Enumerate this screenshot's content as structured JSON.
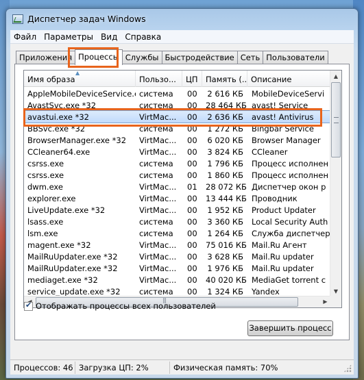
{
  "window": {
    "title": "Диспетчер задач Windows"
  },
  "menu": [
    "Файл",
    "Параметры",
    "Вид",
    "Справка"
  ],
  "tabs": [
    "Приложения",
    "Процессы",
    "Службы",
    "Быстродействие",
    "Сеть",
    "Пользователи"
  ],
  "active_tab": "Процессы",
  "columns": [
    "Имя образа",
    "Пользо...",
    "ЦП",
    "Память (...",
    "Описание"
  ],
  "sorted_column": "Имя образа",
  "processes": [
    {
      "name": "AppleMobileDeviceService.exe",
      "user": "система",
      "cpu": "00",
      "mem": "2 616 КБ",
      "desc": "MobileDeviceServi"
    },
    {
      "name": "AvastSvc.exe *32",
      "user": "система",
      "cpu": "00",
      "mem": "28 464 КБ",
      "desc": "avast! Service"
    },
    {
      "name": "avastui.exe *32",
      "user": "VirtMac...",
      "cpu": "00",
      "mem": "2 636 КБ",
      "desc": "avast! Antivirus"
    },
    {
      "name": "BBSvc.exe *32",
      "user": "система",
      "cpu": "00",
      "mem": "1 272 КБ",
      "desc": "Bingbar Service"
    },
    {
      "name": "BrowserManager.exe *32",
      "user": "VirtMac...",
      "cpu": "00",
      "mem": "6 020 КБ",
      "desc": "Browser Manager"
    },
    {
      "name": "CCleaner64.exe",
      "user": "VirtMac...",
      "cpu": "00",
      "mem": "3 824 КБ",
      "desc": "CCleaner"
    },
    {
      "name": "csrss.exe",
      "user": "система",
      "cpu": "00",
      "mem": "1 796 КБ",
      "desc": "Процесс исполнен"
    },
    {
      "name": "csrss.exe",
      "user": "система",
      "cpu": "00",
      "mem": "1 860 КБ",
      "desc": "Процесс исполнен"
    },
    {
      "name": "dwm.exe",
      "user": "VirtMac...",
      "cpu": "01",
      "mem": "28 072 КБ",
      "desc": "Диспетчер окон р"
    },
    {
      "name": "explorer.exe",
      "user": "VirtMac...",
      "cpu": "00",
      "mem": "13 444 КБ",
      "desc": "Проводник"
    },
    {
      "name": "LiveUpdate.exe *32",
      "user": "VirtMac...",
      "cpu": "00",
      "mem": "1 952 КБ",
      "desc": "Product Updater"
    },
    {
      "name": "lsass.exe",
      "user": "система",
      "cpu": "00",
      "mem": "3 360 КБ",
      "desc": "Local Security Auth"
    },
    {
      "name": "lsm.exe",
      "user": "система",
      "cpu": "00",
      "mem": "1 264 КБ",
      "desc": "Служба диспетчер"
    },
    {
      "name": "magent.exe *32",
      "user": "VirtMac...",
      "cpu": "00",
      "mem": "75 016 КБ",
      "desc": "Mail.Ru Агент"
    },
    {
      "name": "MailRuUpdater.exe *32",
      "user": "VirtMac...",
      "cpu": "00",
      "mem": "3 628 КБ",
      "desc": "Mail.Ru updater"
    },
    {
      "name": "MailRuUpdater.exe *32",
      "user": "VirtMac...",
      "cpu": "00",
      "mem": "1 976 КБ",
      "desc": "Mail.Ru updater"
    },
    {
      "name": "mediaget.exe *32",
      "user": "VirtMac...",
      "cpu": "00",
      "mem": "40 020 КБ",
      "desc": "MediaGet torrent c"
    },
    {
      "name": "service_update.exe *32",
      "user": "система",
      "cpu": "00",
      "mem": "1 324 КБ",
      "desc": "Yandex"
    }
  ],
  "selected_row": "avastui.exe *32",
  "show_all_users": {
    "label": "Отображать процессы всех пользователей",
    "checked": true
  },
  "end_process_button": "Завершить процесс",
  "status": {
    "processes": "Процессов: 46",
    "cpu": "Загрузка ЦП: 2%",
    "memory": "Физическая память: 70%"
  },
  "colors": {
    "highlight_annotation": "#e8641c",
    "selection": "#c1dbfc"
  }
}
